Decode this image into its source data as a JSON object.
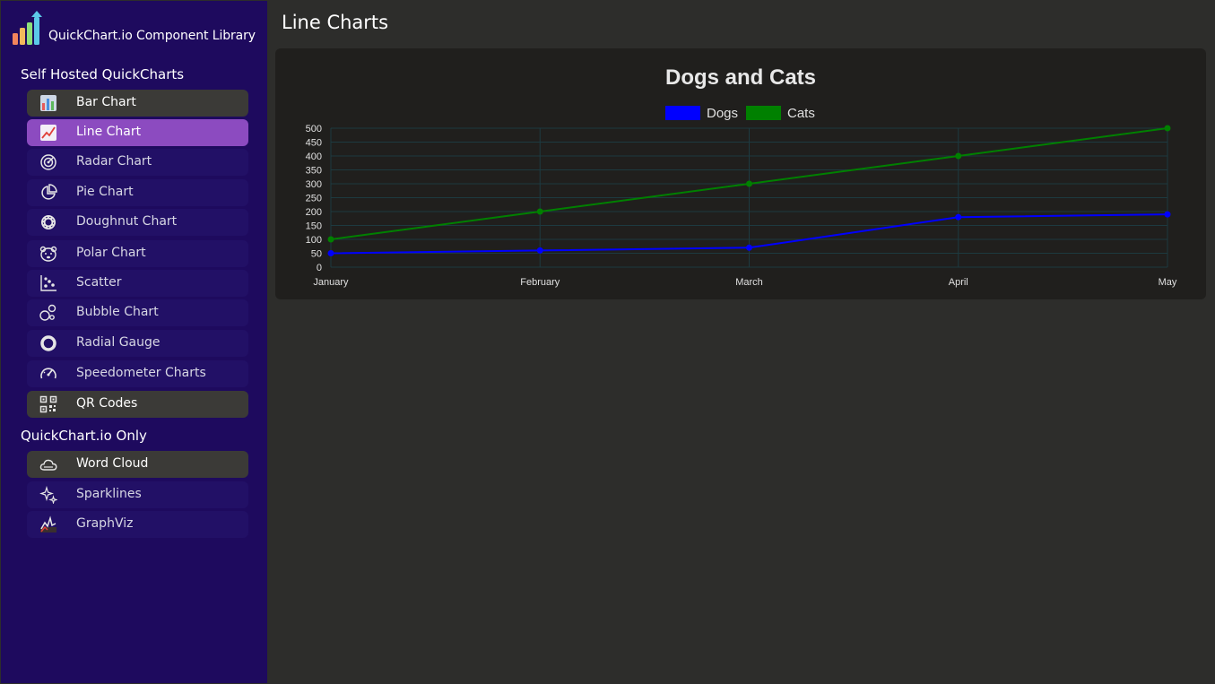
{
  "brand": {
    "title": "QuickChart.io Component Library",
    "logo_icon": "bar-chart-logo-icon"
  },
  "sidebar": {
    "sections": [
      {
        "heading": "Self Hosted QuickCharts",
        "items": [
          {
            "label": "Bar Chart",
            "icon": "bar-chart-icon",
            "state": "boxed"
          },
          {
            "label": "Line Chart",
            "icon": "line-chart-icon",
            "state": "active"
          },
          {
            "label": "Radar Chart",
            "icon": "radar-icon",
            "state": "normal"
          },
          {
            "label": "Pie Chart",
            "icon": "pie-chart-icon",
            "state": "normal"
          },
          {
            "label": "Doughnut Chart",
            "icon": "doughnut-icon",
            "state": "normal"
          },
          {
            "label": "Polar Chart",
            "icon": "polar-bear-icon",
            "state": "normal"
          },
          {
            "label": "Scatter",
            "icon": "scatter-icon",
            "state": "normal"
          },
          {
            "label": "Bubble Chart",
            "icon": "bubbles-icon",
            "state": "normal"
          },
          {
            "label": "Radial Gauge",
            "icon": "ring-icon",
            "state": "normal"
          },
          {
            "label": "Speedometer Charts",
            "icon": "speedometer-icon",
            "state": "normal"
          },
          {
            "label": "QR Codes",
            "icon": "qr-code-icon",
            "state": "boxed"
          }
        ]
      },
      {
        "heading": "QuickChart.io Only",
        "items": [
          {
            "label": "Word Cloud",
            "icon": "cloud-icon",
            "state": "boxed"
          },
          {
            "label": "Sparklines",
            "icon": "sparkles-icon",
            "state": "normal"
          },
          {
            "label": "GraphViz",
            "icon": "graph-icon",
            "state": "normal"
          }
        ]
      }
    ]
  },
  "main": {
    "title": "Line Charts"
  },
  "colors": {
    "accent": "#8c4bc0",
    "sidebar": "#1e0a5e",
    "dogs": "#0000ff",
    "cats": "#008000"
  },
  "chart_data": {
    "type": "line",
    "title": "Dogs and Cats",
    "categories": [
      "January",
      "February",
      "March",
      "April",
      "May"
    ],
    "series": [
      {
        "name": "Dogs",
        "values": [
          50,
          60,
          70,
          180,
          190
        ],
        "color": "#0000ff"
      },
      {
        "name": "Cats",
        "values": [
          100,
          200,
          300,
          400,
          500
        ],
        "color": "#008000"
      }
    ],
    "ylim": [
      0,
      500
    ],
    "yticks": [
      0,
      50,
      100,
      150,
      200,
      250,
      300,
      350,
      400,
      450,
      500
    ],
    "grid": true,
    "legend": "top"
  }
}
